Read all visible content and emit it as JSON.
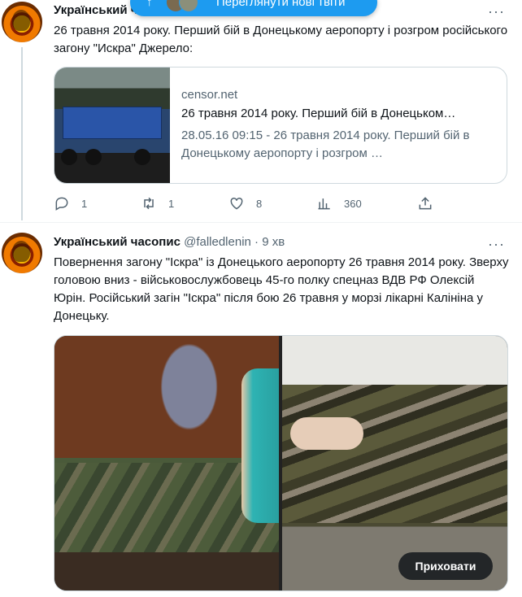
{
  "new_tweets_pill": {
    "label": "Переглянути нові твіти"
  },
  "tweet1": {
    "author_name": "Український часопис",
    "text": "26 травня 2014 року. Перший бій в Донецькому аеропорту і розгром російського загону \"Искра\" Джерело:",
    "card": {
      "domain": "censor.net",
      "title": "26 травня 2014 року. Перший бій в Донецьком…",
      "description": "28.05.16 09:15 - 26 травня 2014 року. Перший бій в Донецькому аеропорту і розгром …"
    },
    "actions": {
      "reply_count": "1",
      "retweet_count": "1",
      "like_count": "8",
      "views_count": "360"
    }
  },
  "tweet2": {
    "author_name": "Український часопис",
    "handle": "@falledlenin",
    "separator": "·",
    "time": "9 хв",
    "text": "Повернення загону \"Іскра\" із Донецького аеропорту 26 травня 2014 року. Зверху головою вниз - військовослужбовець 45-го полку спецназ ВДВ РФ Олексій Юрін. Російський загін \"Іскра\" після бою 26 травня у морзі лікарні Калініна у Донецьку.",
    "hide_button": "Приховати"
  },
  "icons": {
    "reply": "reply-icon",
    "retweet": "retweet-icon",
    "like": "heart-icon",
    "views": "views-icon",
    "share": "share-icon",
    "more": "more-icon",
    "arrow_up": "arrow-up-icon"
  },
  "colors": {
    "accent": "#1d9bf0",
    "text_primary": "#0f1419",
    "text_secondary": "#536471",
    "border": "#cfd9de"
  }
}
